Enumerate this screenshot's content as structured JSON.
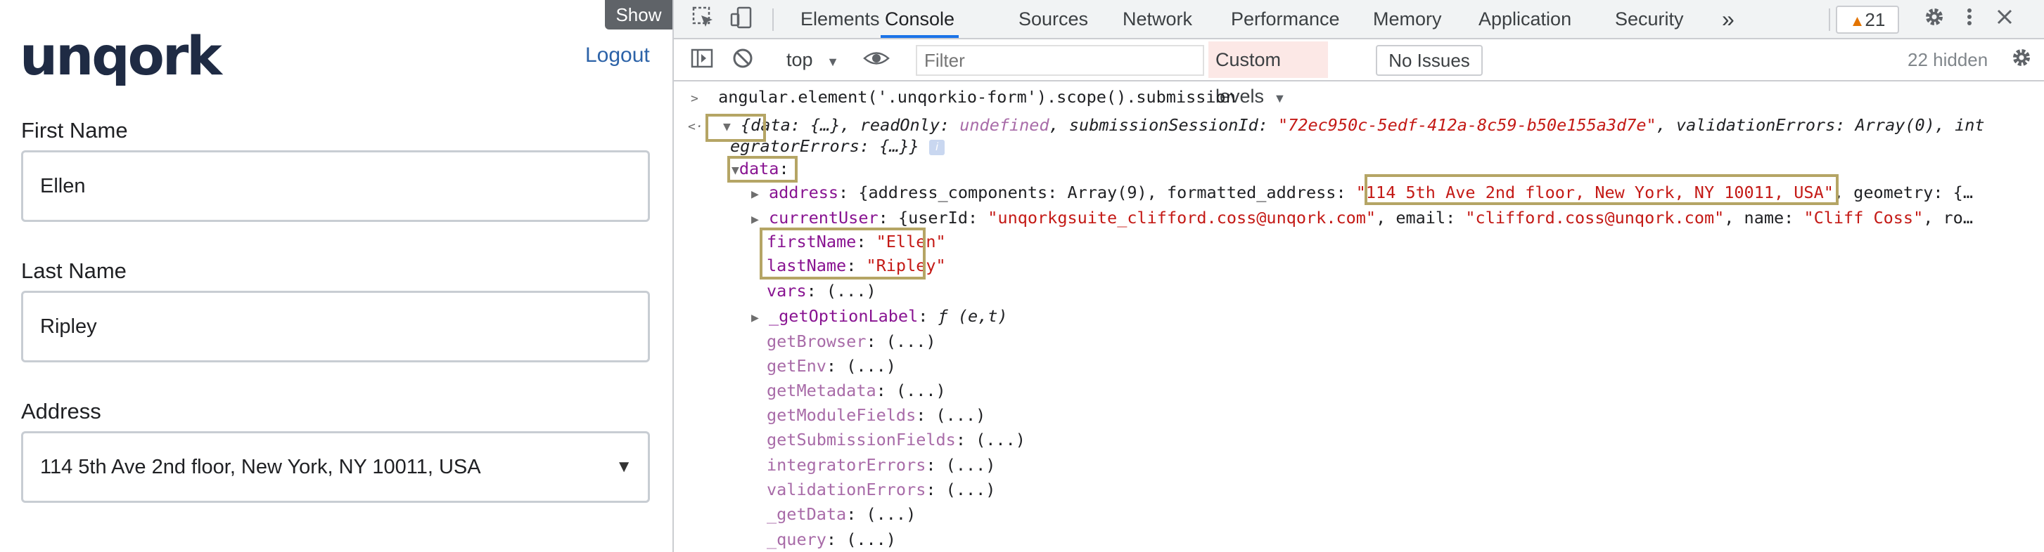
{
  "app": {
    "logo": "unqork",
    "logout": "Logout",
    "show_button": "Show",
    "fields": [
      {
        "label": "First Name",
        "value": "Ellen"
      },
      {
        "label": "Last Name",
        "value": "Ripley"
      },
      {
        "label": "Address",
        "value": "114 5th Ave 2nd floor, New York, NY 10011, USA"
      }
    ]
  },
  "devtools": {
    "tabs": [
      "Elements",
      "Console",
      "Sources",
      "Network",
      "Performance",
      "Memory",
      "Application",
      "Security"
    ],
    "more_tabs": "»",
    "warnings_count": "21",
    "toolbar": {
      "context": "top",
      "filter_placeholder": "Filter",
      "levels": "Custom levels",
      "issues": "No Issues",
      "hidden": "22 hidden"
    },
    "console": {
      "command": "angular.element('.unqorkio-form').scope().submission",
      "summary": {
        "data_key": "data",
        "data_val": "{…}",
        "readonly_key": "readOnly",
        "readonly_val": "undefined",
        "session_key": "submissionSessionId",
        "session_val": "\"72ec950c-5edf-412a-8c59-b50e155a3d7e\"",
        "validation_key": "validationErrors",
        "validation_val": "Array(0)",
        "integrator_key_start": "int",
        "integrator_key_end": "egratorErrors",
        "integrator_val": "{…}}",
        "info": "i"
      },
      "data_label": "data",
      "address": {
        "key": "address",
        "prefix": "{address_components: Array(9), formatted_address: ",
        "formatted": "\"114 5th Ave 2nd floor, New York, NY 10011, USA\"",
        "suffix": ", geometry: {…"
      },
      "current_user": {
        "key": "currentUser",
        "p1": "{userId: ",
        "user_id": "\"unqorkgsuite_clifford.coss@unqork.com\"",
        "p2": ", email: ",
        "email": "\"clifford.coss@unqork.com\"",
        "p3": ", name: ",
        "name": "\"Cliff Coss\"",
        "p4": ", ro…"
      },
      "first_name": {
        "key": "firstName",
        "value": "\"Ellen\""
      },
      "last_name": {
        "key": "lastName",
        "value": "\"Ripley\""
      },
      "vars": {
        "key": "vars",
        "value": "(...)"
      },
      "get_option_label": {
        "key": "_getOptionLabel",
        "value": "ƒ (e,t)"
      },
      "getters": [
        "getBrowser",
        "getEnv",
        "getMetadata",
        "getModuleFields",
        "getSubmissionFields",
        "integratorErrors",
        "validationErrors",
        "_getData",
        "_query"
      ],
      "getter_value": "(...)"
    }
  }
}
